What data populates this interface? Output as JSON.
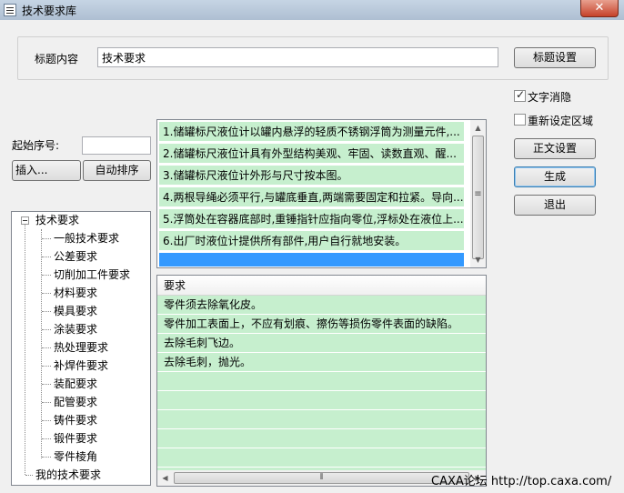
{
  "window": {
    "title": "技术要求库",
    "close_glyph": "✕"
  },
  "header": {
    "title_label": "标题内容",
    "title_value": "技术要求",
    "title_settings_button": "标题设置"
  },
  "options": {
    "text_blanking": {
      "label": "文字消隐",
      "checked": true
    },
    "reset_area": {
      "label": "重新设定区域",
      "checked": false
    }
  },
  "buttons": {
    "body_settings": "正文设置",
    "generate": "生成",
    "exit": "退出",
    "insert": "插入...",
    "auto_sort": "自动排序"
  },
  "start_number": {
    "label": "起始序号:",
    "value": ""
  },
  "tree": {
    "root": "技术要求",
    "children": [
      "一般技术要求",
      "公差要求",
      "切削加工件要求",
      "材料要求",
      "模具要求",
      "涂装要求",
      "热处理要求",
      "补焊件要求",
      "装配要求",
      "配管要求",
      "铸件要求",
      "锻件要求",
      "零件棱角"
    ],
    "sibling": "我的技术要求"
  },
  "selected_items": [
    "1.储罐标尺液位计以罐内悬浮的轻质不锈钢浮筒为测量元件,...",
    "2.储罐标尺液位计具有外型结构美观、牢固、读数直观、醒...",
    "3.储罐标尺液位计外形与尺寸按本图。",
    "4.两根导绳必须平行,与罐底垂直,两端需要固定和拉紧。导向...",
    "5.浮筒处在容器底部时,重锤指针应指向零位,浮标处在液位上...",
    "6.出厂时液位计提供所有部件,用户自行就地安装。",
    ""
  ],
  "requirements_table": {
    "column_header": "要求",
    "rows": [
      "零件须去除氧化皮。",
      "零件加工表面上，不应有划痕、擦伤等损伤零件表面的缺陷。",
      "去除毛刺飞边。",
      "去除毛刺，抛光。"
    ]
  },
  "watermark": "CAXA论坛  http://top.caxa.com/",
  "colors": {
    "row_bg": "#c6efce",
    "selection": "#3399ff"
  },
  "icons": {
    "scroll_up": "▲",
    "scroll_down": "▼",
    "scroll_left": "◀",
    "scroll_right": "▶",
    "grip_v": "≡",
    "grip_h": "⦀"
  }
}
